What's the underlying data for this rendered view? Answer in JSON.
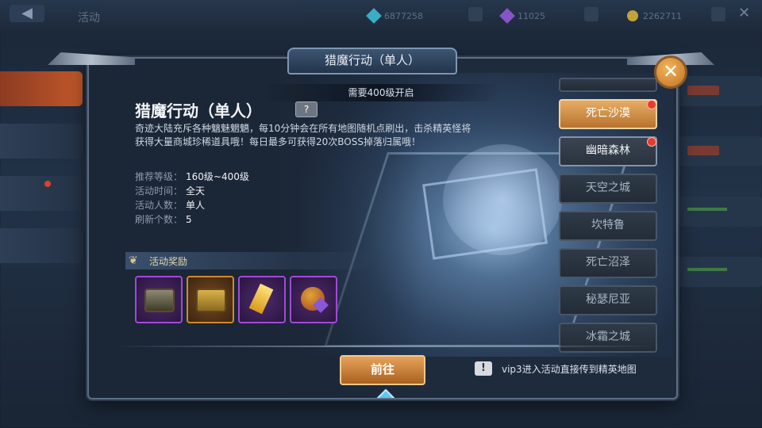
{
  "background": {
    "top_title": "活动",
    "back_label": "◀",
    "resources": [
      {
        "icon": "blue-diamond-icon",
        "value": "6877258",
        "color": "#3ec6e0"
      },
      {
        "icon": "purple-crystal-icon",
        "value": "11025",
        "color": "#9b5de0"
      },
      {
        "icon": "gold-coin-icon",
        "value": "2262711",
        "color": "#e0b93a"
      }
    ],
    "close_label": "✕"
  },
  "dialog": {
    "tab_title": "猎魔行动（单人）",
    "unlock_text": "需要400级开启",
    "event_title": "猎魔行动（单人）",
    "help_label": "?",
    "description": "奇迹大陆充斥各种魑魅魍魉，每10分钟会在所有地图随机点刷出，击杀精英怪将获得大量商城珍稀道具哦！每日最多可获得20次BOSS掉落归属哦！",
    "info": [
      {
        "key": "推荐等级：",
        "value": "160级~400级"
      },
      {
        "key": "活动时间：",
        "value": "全天"
      },
      {
        "key": "活动人数：",
        "value": "单人"
      },
      {
        "key": "刷新个数：",
        "value": "5"
      }
    ],
    "rewards_title": "活动奖励",
    "rewards": [
      {
        "icon": "dark-chest-icon",
        "rarity": "purple"
      },
      {
        "icon": "gold-chest-icon",
        "rarity": "gold"
      },
      {
        "icon": "gold-crystal-icon",
        "rarity": "purple"
      },
      {
        "icon": "treasure-bag-icon",
        "rarity": "purple"
      }
    ],
    "go_button": "前往",
    "tip_icon": "!",
    "tip_text": "vip3进入活动直接传到精英地图",
    "close_label": "✕",
    "maps": [
      {
        "label": "",
        "state": "cut"
      },
      {
        "label": "死亡沙漠",
        "state": "selected",
        "red_dot": true
      },
      {
        "label": "幽暗森林",
        "state": "lit",
        "red_dot": true
      },
      {
        "label": "天空之城",
        "state": "normal",
        "red_dot": false
      },
      {
        "label": "坎特鲁",
        "state": "normal",
        "red_dot": false
      },
      {
        "label": "死亡沼泽",
        "state": "normal",
        "red_dot": false
      },
      {
        "label": "秘瑟尼亚",
        "state": "normal",
        "red_dot": false
      },
      {
        "label": "冰霜之城",
        "state": "normal",
        "red_dot": false
      }
    ]
  }
}
